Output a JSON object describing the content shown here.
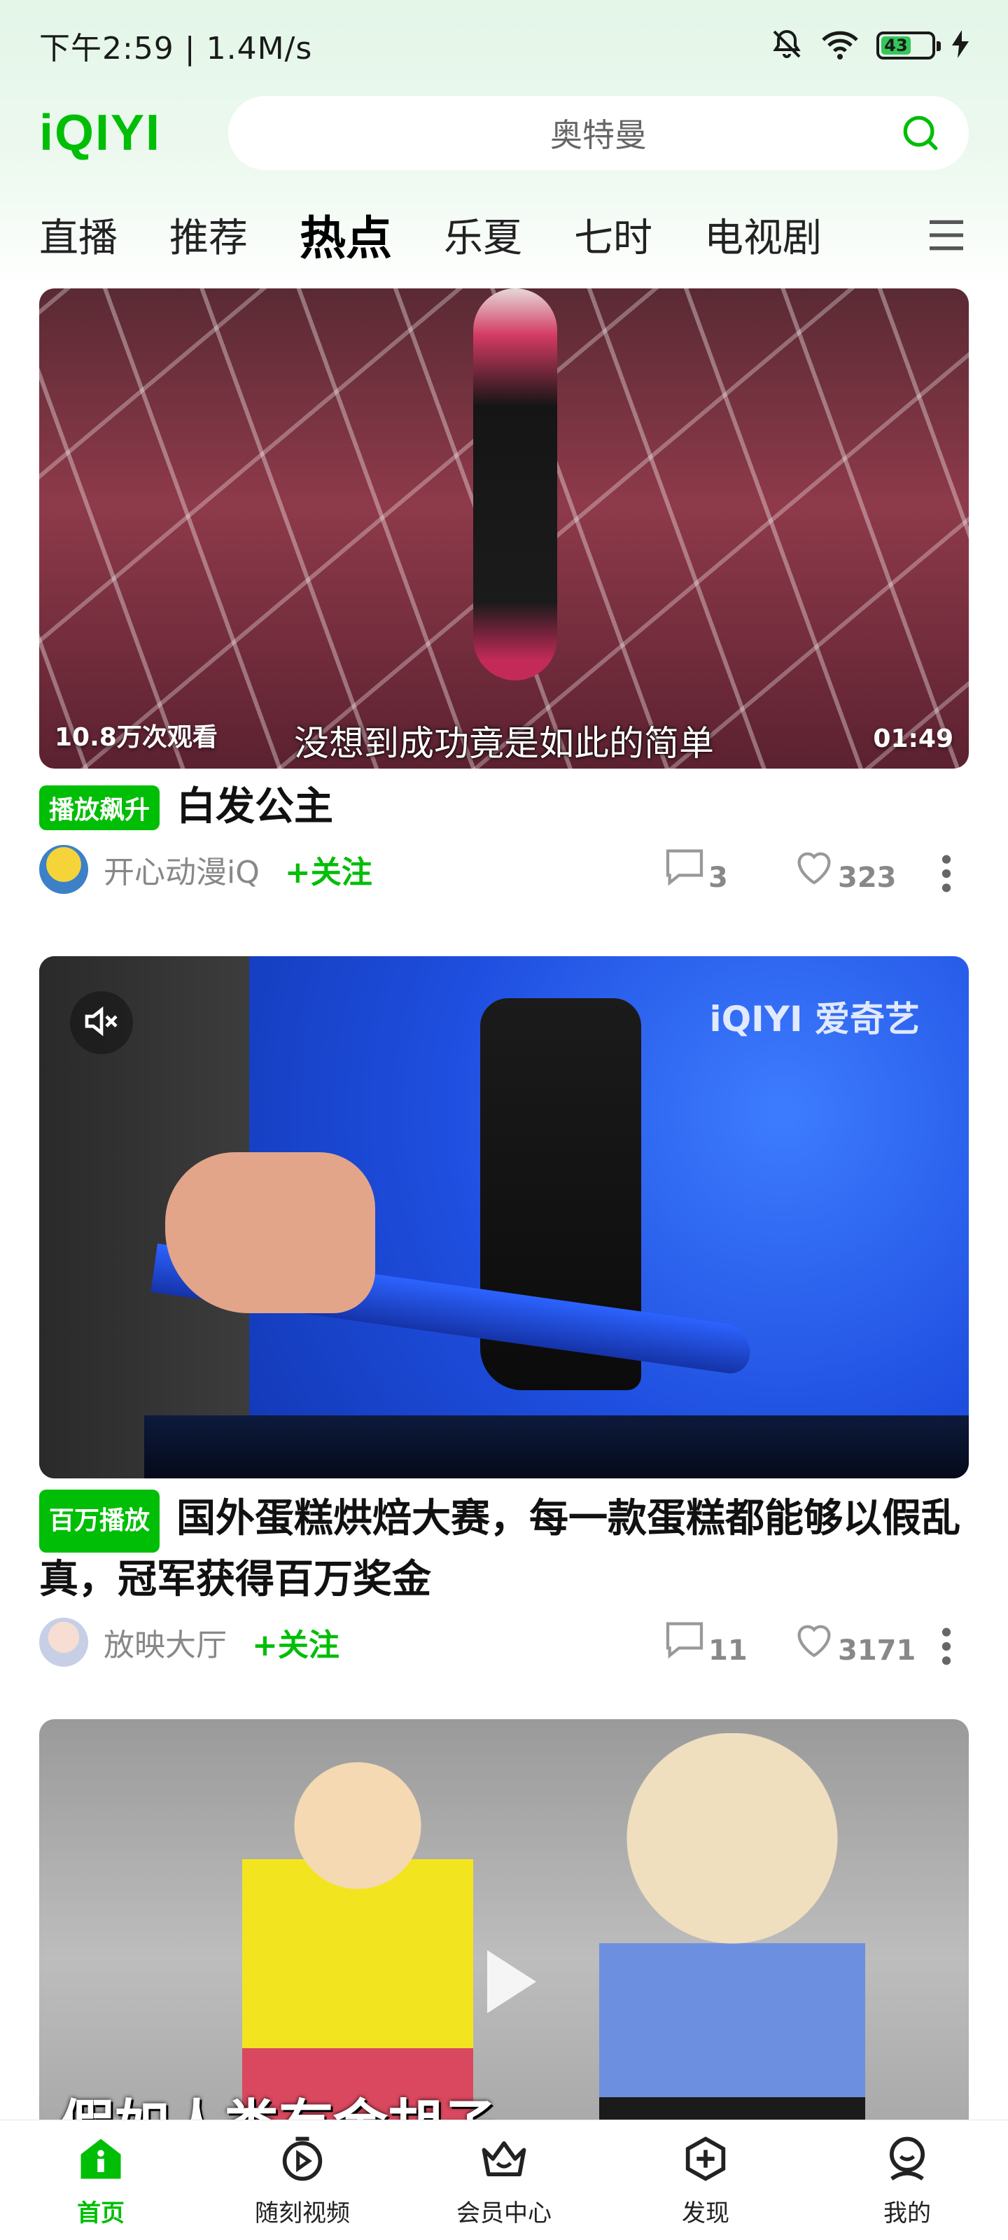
{
  "status_bar": {
    "time_speed": "下午2:59 | 1.4M/s",
    "battery_level": "43"
  },
  "header": {
    "logo": "iQIYI",
    "search_placeholder": "奥特曼"
  },
  "tabs": [
    {
      "label": "直播",
      "active": false
    },
    {
      "label": "推荐",
      "active": false
    },
    {
      "label": "热点",
      "active": true
    },
    {
      "label": "乐夏",
      "active": false
    },
    {
      "label": "七时",
      "active": false
    },
    {
      "label": "电视剧",
      "active": false
    }
  ],
  "feed": [
    {
      "views": "10.8万次观看",
      "subtitle": "没想到成功竟是如此的简单",
      "duration": "01:49",
      "badge": "播放飙升",
      "title": "白发公主",
      "author": "开心动漫iQ",
      "follow": "+关注",
      "comments": "3",
      "likes": "323"
    },
    {
      "watermark": "iQIYI 爱奇艺",
      "badge": "百万播放",
      "title": "国外蛋糕烘焙大赛，每一款蛋糕都能够以假乱真，冠军获得百万奖金",
      "author": "放映大厅",
      "follow": "+关注",
      "comments": "11",
      "likes": "3171"
    },
    {
      "overlay_title": "假如人类有金胡子"
    }
  ],
  "bottom_nav": [
    {
      "label": "首页",
      "icon": "home-icon",
      "active": true
    },
    {
      "label": "随刻视频",
      "icon": "video-icon",
      "active": false
    },
    {
      "label": "会员中心",
      "icon": "vip-crown-icon",
      "active": false
    },
    {
      "label": "发现",
      "icon": "discover-plus-icon",
      "active": false
    },
    {
      "label": "我的",
      "icon": "profile-icon",
      "active": false
    }
  ],
  "colors": {
    "brand": "#00be06",
    "badge_bg": "#00be06"
  }
}
